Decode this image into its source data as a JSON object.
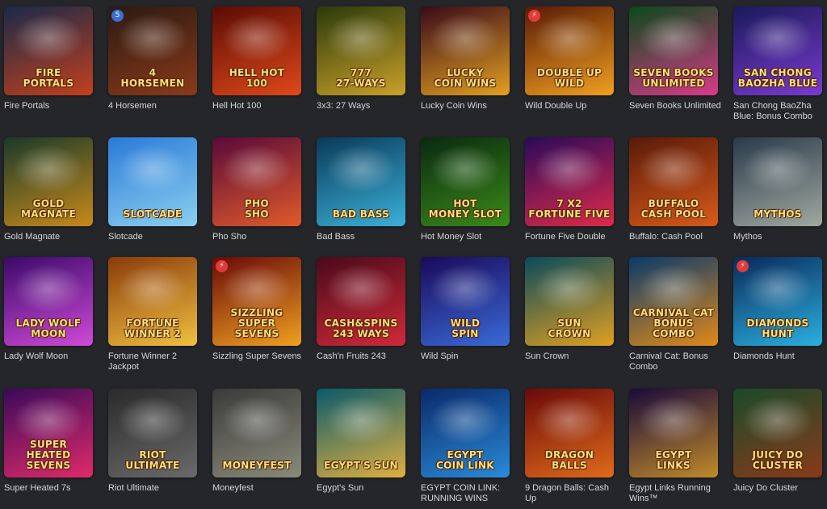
{
  "games": [
    {
      "name": "Fire Portals",
      "logo": "Fire\nPortals",
      "colors": [
        "#1a2a4a",
        "#c2401c"
      ],
      "badge": ""
    },
    {
      "name": "4 Horsemen",
      "logo": "4\nHorsemen",
      "colors": [
        "#2b1a12",
        "#8a3a1a"
      ],
      "badge": "5"
    },
    {
      "name": "Hell Hot 100",
      "logo": "Hell Hot\n100",
      "colors": [
        "#5a0c05",
        "#e0481a"
      ],
      "badge": ""
    },
    {
      "name": "3x3: 27 Ways",
      "logo": "777\n27-Ways",
      "colors": [
        "#2a3a0a",
        "#c9a12a"
      ],
      "badge": ""
    },
    {
      "name": "Lucky Coin Wins",
      "logo": "Lucky\nCoin Wins",
      "colors": [
        "#3a0a1a",
        "#e2a020"
      ],
      "badge": ""
    },
    {
      "name": "Wild Double Up",
      "logo": "Double Up\nWild",
      "colors": [
        "#5a1a05",
        "#f0a020"
      ],
      "badge": "⚡"
    },
    {
      "name": "Seven Books Unlimited",
      "logo": "Seven Books\nUnlimited",
      "colors": [
        "#0a4a1a",
        "#d83a8a"
      ],
      "badge": ""
    },
    {
      "name": "San Chong BaoZha Blue: Bonus Combo",
      "logo": "San Chong\nBaoZha Blue",
      "colors": [
        "#1a1a5a",
        "#7a3ad0"
      ],
      "badge": ""
    },
    {
      "name": "Gold Magnate",
      "logo": "Gold\nMagnate",
      "colors": [
        "#1a3a2a",
        "#c88a1a"
      ],
      "badge": ""
    },
    {
      "name": "Slotcade",
      "logo": "Slotcade",
      "colors": [
        "#2a7ad8",
        "#8ad0f0"
      ],
      "badge": ""
    },
    {
      "name": "Pho Sho",
      "logo": "Pho\nSho",
      "colors": [
        "#5a0a3a",
        "#e05a2a"
      ],
      "badge": ""
    },
    {
      "name": "Bad Bass",
      "logo": "Bad Bass",
      "colors": [
        "#0a3a5a",
        "#3ab0d8"
      ],
      "badge": ""
    },
    {
      "name": "Hot Money Slot",
      "logo": "Hot\nMoney Slot",
      "colors": [
        "#0a2a10",
        "#3a8a1a"
      ],
      "badge": ""
    },
    {
      "name": "Fortune Five Double",
      "logo": "7 x2\nFortune Five",
      "colors": [
        "#2a0a5a",
        "#e02a4a"
      ],
      "badge": ""
    },
    {
      "name": "Buffalo: Cash Pool",
      "logo": "Buffalo\nCash Pool",
      "colors": [
        "#5a1a0a",
        "#d85a1a"
      ],
      "badge": ""
    },
    {
      "name": "Mythos",
      "logo": "Mythos",
      "colors": [
        "#2a3a4a",
        "#a0a8a0"
      ],
      "badge": ""
    },
    {
      "name": "Lady Wolf Moon",
      "logo": "Lady Wolf\nMoon",
      "colors": [
        "#3a0a6a",
        "#d04ad8"
      ],
      "badge": ""
    },
    {
      "name": "Fortune Winner 2 Jackpot",
      "logo": "Fortune\nWinner 2",
      "colors": [
        "#8a3a0a",
        "#f0c040"
      ],
      "badge": ""
    },
    {
      "name": "Sizzling Super Sevens",
      "logo": "Sizzling\nSuper Sevens",
      "colors": [
        "#6a0a0a",
        "#f0a020"
      ],
      "badge": "⚡"
    },
    {
      "name": "Cash'n Fruits 243",
      "logo": "Cash&Spins\n243 ways",
      "colors": [
        "#4a0a1a",
        "#d02a3a"
      ],
      "badge": ""
    },
    {
      "name": "Wild Spin",
      "logo": "Wild\nSpin",
      "colors": [
        "#1a0a5a",
        "#3a6ad8"
      ],
      "badge": ""
    },
    {
      "name": "Sun Crown",
      "logo": "Sun\nCrown",
      "colors": [
        "#0a4a5a",
        "#e0a020"
      ],
      "badge": ""
    },
    {
      "name": "Carnival Cat: Bonus Combo",
      "logo": "Carnival Cat\nBonus Combo",
      "colors": [
        "#0a3a6a",
        "#e08a1a"
      ],
      "badge": ""
    },
    {
      "name": "Diamonds Hunt",
      "logo": "Diamonds\nHunt",
      "colors": [
        "#0a2a5a",
        "#2ab0e0"
      ],
      "badge": "⚡"
    },
    {
      "name": "Super Heated 7s",
      "logo": "Super Heated\nSevens",
      "colors": [
        "#3a0a5a",
        "#e02a6a"
      ],
      "badge": ""
    },
    {
      "name": "Riot Ultimate",
      "logo": "Riot\nUltimate",
      "colors": [
        "#2a2a2a",
        "#6a6a6a"
      ],
      "badge": ""
    },
    {
      "name": "Moneyfest",
      "logo": "Moneyfest",
      "colors": [
        "#3a3a3a",
        "#8a8a7a"
      ],
      "badge": ""
    },
    {
      "name": "Egypt's Sun",
      "logo": "Egypt's Sun",
      "colors": [
        "#0a5a6a",
        "#e0b040"
      ],
      "badge": ""
    },
    {
      "name": "EGYPT COIN LINK: RUNNING WINS",
      "logo": "Egypt\nCoin Link",
      "colors": [
        "#0a2a6a",
        "#2a8ad8"
      ],
      "badge": ""
    },
    {
      "name": "9 Dragon Balls: Cash Up",
      "logo": "Dragon\nBalls",
      "colors": [
        "#6a0a0a",
        "#e06a1a"
      ],
      "badge": ""
    },
    {
      "name": "Egypt Links Running Wins™",
      "logo": "Egypt\nLinks",
      "colors": [
        "#1a0a3a",
        "#c08a2a"
      ],
      "badge": ""
    },
    {
      "name": "Juicy Do Cluster",
      "logo": "Juicy Do\nCluster",
      "colors": [
        "#1a4a2a",
        "#8a3a1a"
      ],
      "badge": ""
    }
  ]
}
